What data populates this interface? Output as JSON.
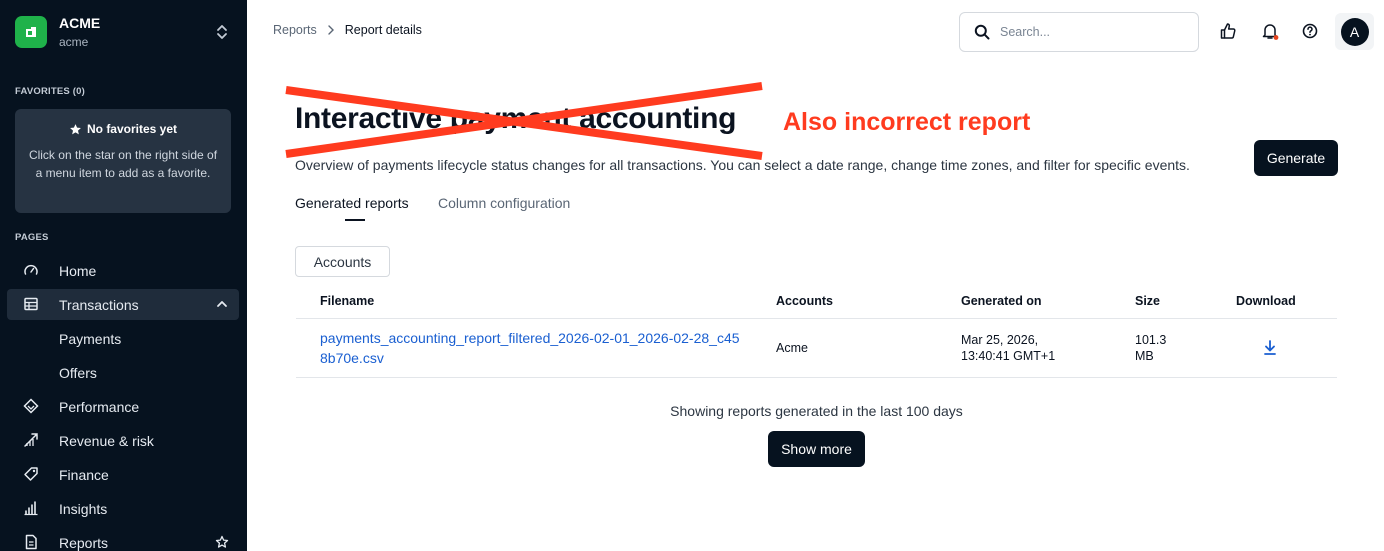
{
  "org": {
    "name": "ACME",
    "sub": "acme"
  },
  "favorites": {
    "label": "FAVORITES (0)",
    "empty_title": "No favorites yet",
    "empty_desc": "Click on the star on the right side of a menu item to add as a favorite."
  },
  "pages_label": "PAGES",
  "nav": {
    "home": "Home",
    "transactions": "Transactions",
    "payments": "Payments",
    "offers": "Offers",
    "performance": "Performance",
    "revenue_risk": "Revenue & risk",
    "finance": "Finance",
    "insights": "Insights",
    "reports": "Reports"
  },
  "breadcrumb": {
    "parent": "Reports",
    "current": "Report details"
  },
  "search": {
    "placeholder": "Search..."
  },
  "avatar": {
    "initial": "A"
  },
  "page": {
    "title": "Interactive payment accounting",
    "annotation": "Also incorrect report",
    "description": "Overview of payments lifecycle status changes for all transactions. You can select a date range, change time zones, and filter for specific events.",
    "generate_label": "Generate"
  },
  "tabs": {
    "generated": "Generated reports",
    "columns": "Column configuration"
  },
  "filter": {
    "accounts_label": "Accounts"
  },
  "table": {
    "headers": {
      "filename": "Filename",
      "accounts": "Accounts",
      "generated_on": "Generated on",
      "size": "Size",
      "download": "Download"
    },
    "rows": [
      {
        "filename": "payments_accounting_report_filtered_2026-02-01_2026-02-28_c458b70e.csv",
        "accounts": "Acme",
        "generated_date": "Mar 25, 2026,",
        "generated_time": "13:40:41 GMT+1",
        "size_value": "101.3",
        "size_unit": "MB"
      }
    ]
  },
  "footer": {
    "showing": "Showing reports generated in the last 100 days",
    "show_more": "Show more"
  },
  "colors": {
    "sidebar_bg": "#06121f",
    "brand_green": "#1fb24a",
    "link_blue": "#1a5fd1",
    "annotation_red": "#ff3b1f",
    "notification_dot": "#e5431c"
  }
}
